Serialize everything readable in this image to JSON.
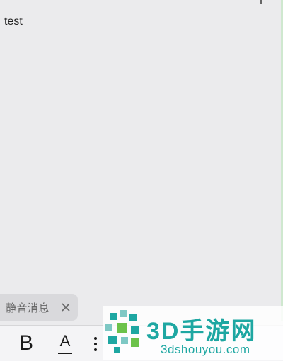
{
  "editor": {
    "body_text": "test"
  },
  "toast": {
    "label": "静音消息",
    "close_icon": "close-icon"
  },
  "toolbar": {
    "bold_label": "B",
    "color_label": "A",
    "list_icon": "list-icon"
  },
  "watermark": {
    "title": "3D手游网",
    "url": "3dshouyou.com"
  },
  "colors": {
    "background": "#ebebed",
    "toolbar": "#f4f4f6",
    "watermark": "#1ea7a2"
  }
}
